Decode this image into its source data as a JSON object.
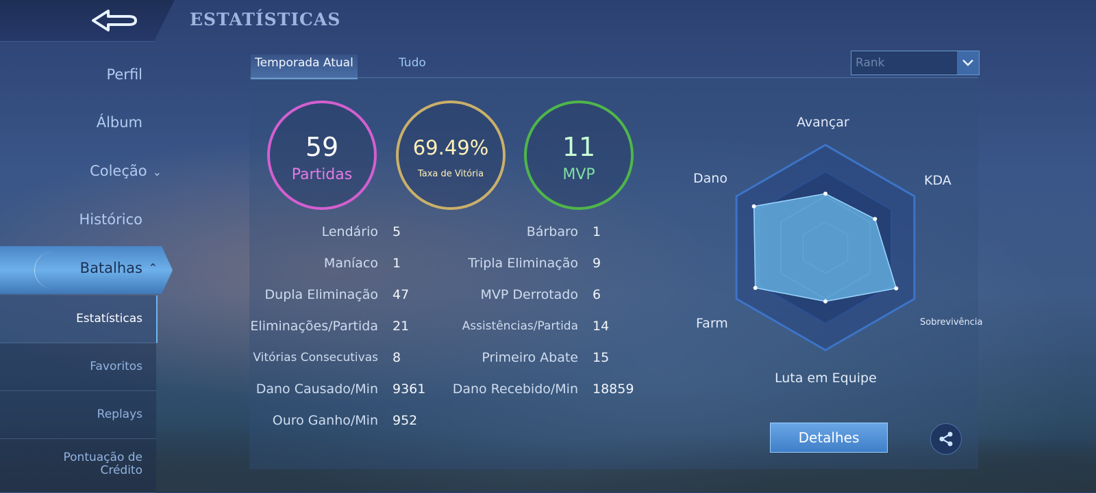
{
  "header": {
    "title": "ESTATÍSTICAS"
  },
  "sidebar": {
    "items": [
      {
        "label": "Perfil"
      },
      {
        "label": "Álbum"
      },
      {
        "label": "Coleção"
      },
      {
        "label": "Histórico"
      },
      {
        "label": "Batalhas"
      }
    ],
    "subitems": [
      {
        "label": "Estatísticas"
      },
      {
        "label": "Favoritos"
      },
      {
        "label": "Replays"
      },
      {
        "label": "Pontuação de Crédito"
      }
    ]
  },
  "tabs": [
    {
      "label": "Temporada Atual"
    },
    {
      "label": "Tudo"
    }
  ],
  "filter": {
    "value": "Rank"
  },
  "summary": {
    "matches": {
      "value": "59",
      "label": "Partidas"
    },
    "winrate": {
      "value": "69.49%",
      "label": "Taxa de Vitória"
    },
    "mvp": {
      "value": "11",
      "label": "MVP"
    }
  },
  "stats_left": [
    {
      "label": "Lendário",
      "value": "5"
    },
    {
      "label": "Maníaco",
      "value": "1"
    },
    {
      "label": "Dupla Eliminação",
      "value": "47"
    },
    {
      "label": "Eliminações/Partida",
      "value": "21"
    },
    {
      "label": "Vitórias Consecutivas",
      "value": "8"
    },
    {
      "label": "Dano Causado/Min",
      "value": "9361"
    },
    {
      "label": "Ouro Ganho/Min",
      "value": "952"
    }
  ],
  "stats_right": [
    {
      "label": "Bárbaro",
      "value": "1"
    },
    {
      "label": "Tripla Eliminação",
      "value": "9"
    },
    {
      "label": "MVP Derrotado",
      "value": "6"
    },
    {
      "label": "Assistências/Partida",
      "value": "14"
    },
    {
      "label": "Primeiro Abate",
      "value": "15"
    },
    {
      "label": "Dano Recebido/Min",
      "value": "18859"
    }
  ],
  "radar": {
    "axes": [
      "Avançar",
      "KDA",
      "Sobrevivência",
      "Luta em Equipe",
      "Farm",
      "Dano"
    ],
    "values": [
      0.64,
      0.68,
      0.97,
      0.64,
      0.96,
      0.98
    ]
  },
  "actions": {
    "details_label": "Detalhes"
  }
}
